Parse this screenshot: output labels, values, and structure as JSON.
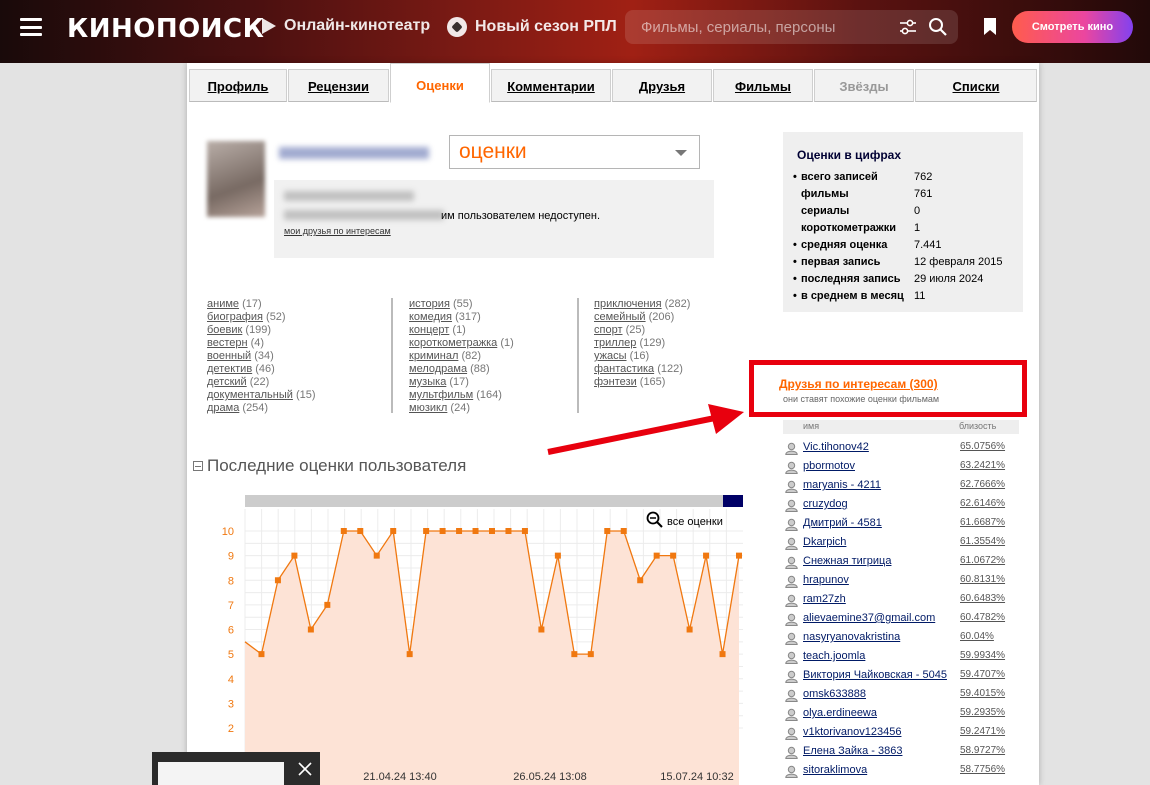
{
  "header": {
    "logo": "КИНОПОИСК",
    "nav_online": "Онлайн-кинотеатр",
    "nav_rpl": "Новый сезон РПЛ",
    "search_placeholder": "Фильмы, сериалы, персоны",
    "watch_button": "Смотреть кино"
  },
  "tabs": [
    "Профиль",
    "Рецензии",
    "Оценки",
    "Комментарии",
    "Друзья",
    "Фильмы",
    "Звёзды",
    "Списки"
  ],
  "profile": {
    "select_value": "оценки",
    "info_text": "им пользователем недоступен.",
    "friends_by_interest_link": "мои друзья по интересам"
  },
  "genres": {
    "col1": [
      [
        "аниме",
        "(17)"
      ],
      [
        "биография",
        "(52)"
      ],
      [
        "боевик",
        "(199)"
      ],
      [
        "вестерн",
        "(4)"
      ],
      [
        "военный",
        "(34)"
      ],
      [
        "детектив",
        "(46)"
      ],
      [
        "детский",
        "(22)"
      ],
      [
        "документальный",
        "(15)"
      ],
      [
        "драма",
        "(254)"
      ]
    ],
    "col2": [
      [
        "история",
        "(55)"
      ],
      [
        "комедия",
        "(317)"
      ],
      [
        "концерт",
        "(1)"
      ],
      [
        "короткометражка",
        "(1)"
      ],
      [
        "криминал",
        "(82)"
      ],
      [
        "мелодрама",
        "(88)"
      ],
      [
        "музыка",
        "(17)"
      ],
      [
        "мультфильм",
        "(164)"
      ],
      [
        "мюзикл",
        "(24)"
      ]
    ],
    "col3": [
      [
        "приключения",
        "(282)"
      ],
      [
        "семейный",
        "(206)"
      ],
      [
        "спорт",
        "(25)"
      ],
      [
        "триллер",
        "(129)"
      ],
      [
        "ужасы",
        "(16)"
      ],
      [
        "фантастика",
        "(122)"
      ],
      [
        "фэнтези",
        "(165)"
      ]
    ]
  },
  "section_title": "Последние оценки пользователя",
  "chart_data": {
    "type": "area",
    "y_ticks": [
      "2",
      "3",
      "4",
      "5",
      "6",
      "7",
      "8",
      "9",
      "10"
    ],
    "x_labels": [
      "21.04.24 13:40",
      "26.05.24 13:08",
      "15.07.24 10:32"
    ],
    "values": [
      5.5,
      5,
      8,
      9,
      6,
      7,
      10,
      10,
      9,
      10,
      5,
      10,
      10,
      10,
      10,
      10,
      10,
      10,
      6,
      9,
      5,
      5,
      10,
      10,
      8,
      9,
      9,
      6,
      9,
      5,
      9
    ],
    "all_ratings_label": "все оценки",
    "colors": {
      "line": "#f07810",
      "fill": "#fde3d6",
      "tick": "#f07810"
    }
  },
  "stats": {
    "title": "Оценки в цифрах",
    "rows": [
      {
        "k": "всего записей",
        "v": "762",
        "bullet": true
      },
      {
        "k": "фильмы",
        "v": "761",
        "bullet": false
      },
      {
        "k": "сериалы",
        "v": "0",
        "bullet": false
      },
      {
        "k": "короткометражки",
        "v": "1",
        "bullet": false
      },
      {
        "k": "средняя оценка",
        "v": "7.441",
        "bullet": true
      },
      {
        "k": "первая запись",
        "v": "12 февраля 2015",
        "bullet": true
      },
      {
        "k": "последняя запись",
        "v": "29 июля 2024",
        "bullet": true
      },
      {
        "k": "в среднем в месяц",
        "v": "11",
        "bullet": true
      }
    ]
  },
  "friends": {
    "title": "Друзья по интересам (300)",
    "subtitle": "они ставят похожие оценки фильмам",
    "col_name": "имя",
    "col_close": "близость",
    "list": [
      [
        "Vic.tihonov42",
        "65.0756%"
      ],
      [
        "pbormotov",
        "63.2421%"
      ],
      [
        "maryanis - 4211",
        "62.7666%"
      ],
      [
        "cruzydog",
        "62.6146%"
      ],
      [
        "Дмитрий - 4581",
        "61.6687%"
      ],
      [
        "Dkarpich",
        "61.3554%"
      ],
      [
        "Снежная тигрица",
        "61.0672%"
      ],
      [
        "hrapunov",
        "60.8131%"
      ],
      [
        "ram27zh",
        "60.6483%"
      ],
      [
        "alievaemine37@gmail.com",
        "60.4782%"
      ],
      [
        "nasyryanovakristina",
        "60.04%"
      ],
      [
        "teach.joomla",
        "59.9934%"
      ],
      [
        "Виктория Чайковская - 5045",
        "59.4707%"
      ],
      [
        "omsk633888",
        "59.4015%"
      ],
      [
        "olya.erdineewa",
        "59.2935%"
      ],
      [
        "v1ktorivanov123456",
        "59.2471%"
      ],
      [
        "Елена Зайка - 3863",
        "58.9727%"
      ],
      [
        "sitoraklimova",
        "58.7756%"
      ]
    ]
  }
}
